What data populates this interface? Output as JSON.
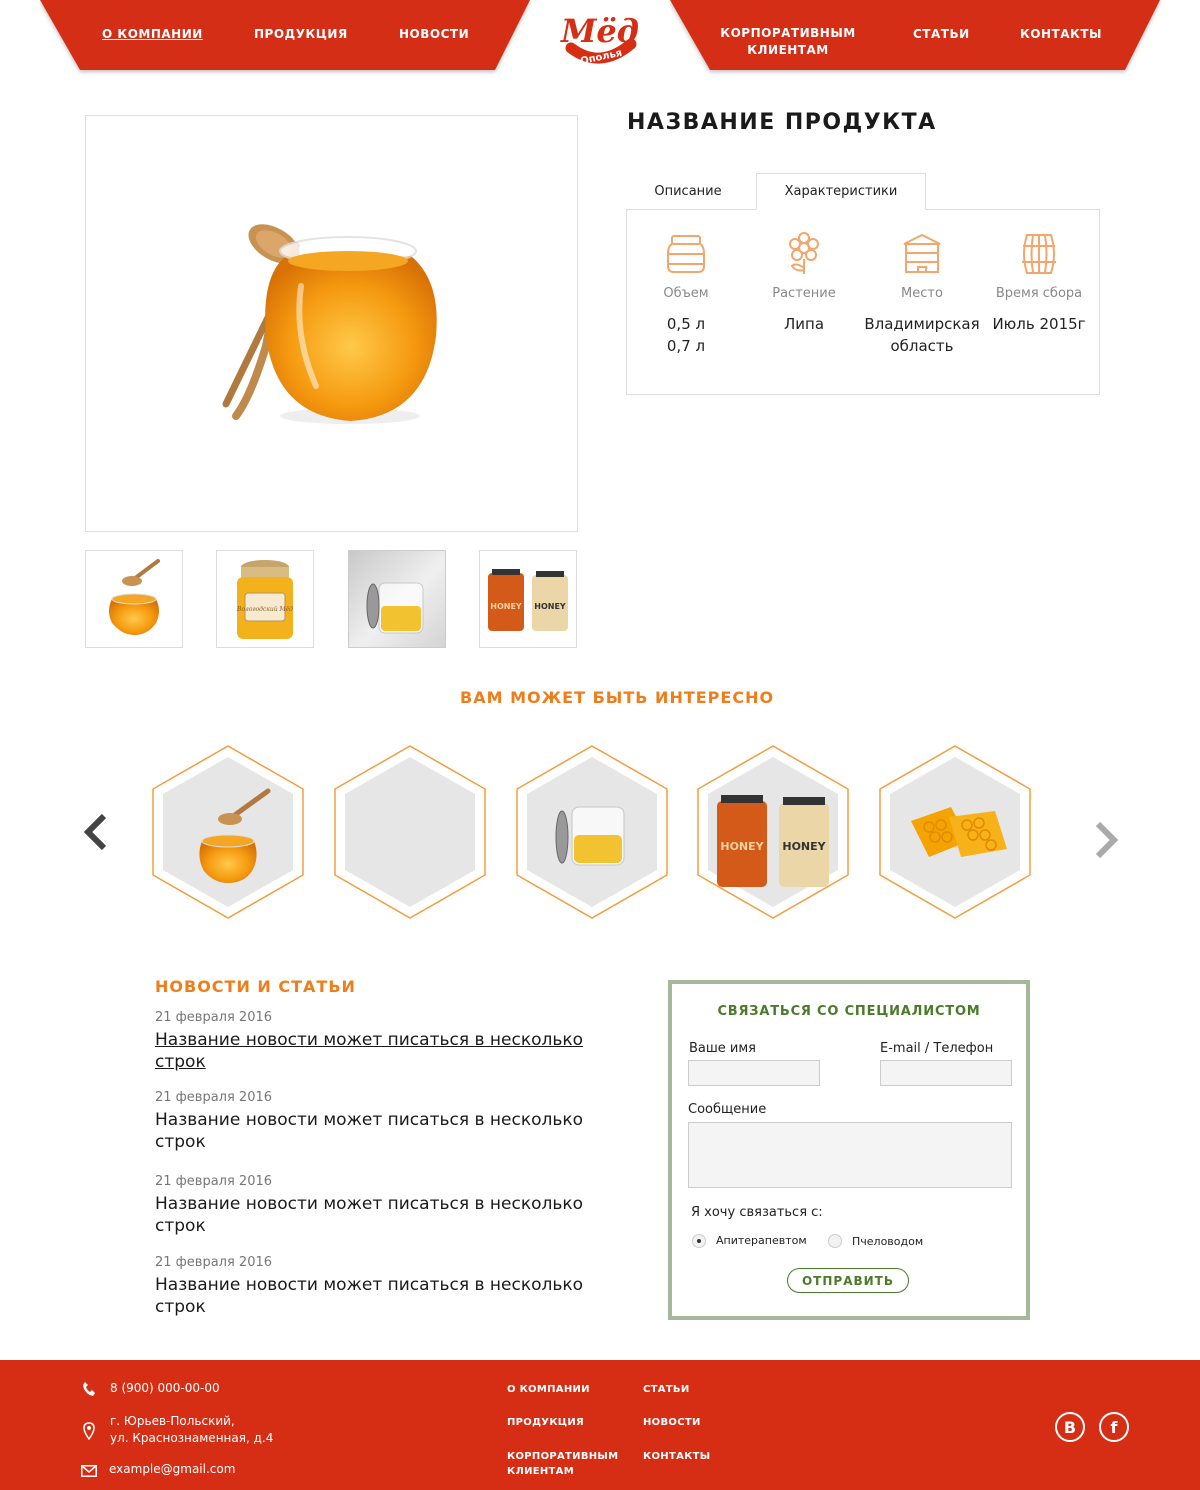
{
  "header": {
    "nav_left": [
      "О КОМПАНИИ",
      "ПРОДУКЦИЯ",
      "НОВОСТИ"
    ],
    "nav_right": [
      "КОРПОРАТИВНЫМ КЛИЕНТАМ",
      "СТАТЬИ",
      "КОНТАКТЫ"
    ],
    "active_item": "О КОМПАНИИ",
    "logo_top": "Мёд",
    "logo_bottom": "Ополья",
    "brand_color": "#d52e14"
  },
  "product": {
    "title": "НАЗВАНИЕ ПРОДУКТА",
    "tabs": [
      "Описание",
      "Характеристики"
    ],
    "active_tab": "Характеристики",
    "specs": [
      {
        "icon": "jar-icon",
        "label": "Объем",
        "value": "0,5 л\n0,7 л"
      },
      {
        "icon": "flower-icon",
        "label": "Растение",
        "value": "Липа"
      },
      {
        "icon": "beehive-icon",
        "label": "Место",
        "value": "Владимирская область"
      },
      {
        "icon": "barrel-icon",
        "label": "Время сбора",
        "value": "Июль 2015г"
      }
    ],
    "thumb_labels": [
      "Вологодский Мёд",
      "HONEY",
      "HONEY"
    ]
  },
  "related": {
    "title": "ВАМ МОЖЕТ БЫТЬ ИНТЕРЕСНО",
    "jar_labels": [
      "HONEY",
      "HONEY"
    ]
  },
  "news": {
    "title": "НОВОСТИ И СТАТЬИ",
    "items": [
      {
        "date": "21 февраля 2016",
        "title": "Название новости может писаться в несколько строк"
      },
      {
        "date": "21 февраля 2016",
        "title": "Название новости может писаться в несколько строк"
      },
      {
        "date": "21 февраля 2016",
        "title": "Название новости может писаться в несколько строк"
      },
      {
        "date": "21 февраля 2016",
        "title": "Название новости может писаться в несколько строк"
      }
    ]
  },
  "contact_form": {
    "title": "СВЯЗАТЬСЯ СО СПЕЦИАЛИСТОМ",
    "name_label": "Ваше имя",
    "contact_label": "E-mail / Телефон",
    "message_label": "Сообщение",
    "choice_label": "Я хочу связаться с:",
    "options": [
      "Апитерапевтом",
      "Пчеловодом"
    ],
    "selected_option": "Апитерапевтом",
    "submit": "ОТПРАВИТЬ",
    "accent_color": "#4a7a2a"
  },
  "footer": {
    "phone": "8 (900) 000-00-00",
    "address_line1": "г. Юрьев-Польский,",
    "address_line2": "ул. Краснознаменная, д.4",
    "email": "example@gmail.com",
    "nav_col1": [
      "О КОМПАНИИ",
      "ПРОДУКЦИЯ",
      "КОРПОРАТИВНЫМ КЛИЕНТАМ"
    ],
    "nav_col2": [
      "СТАТЬИ",
      "НОВОСТИ",
      "КОНТАКТЫ"
    ],
    "social": [
      "В",
      "f"
    ]
  }
}
